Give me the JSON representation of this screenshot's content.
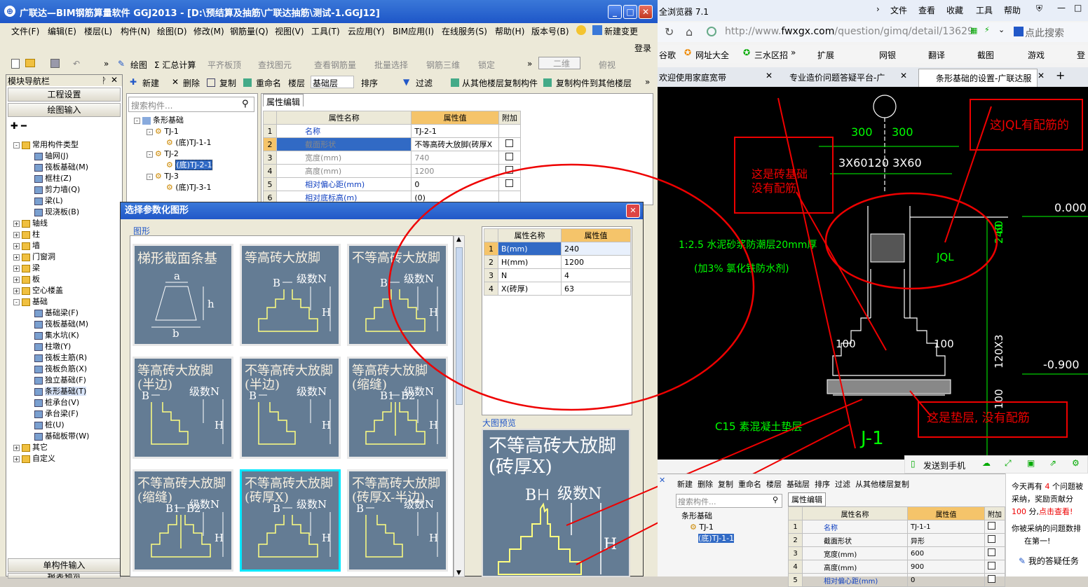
{
  "left_window": {
    "title": "广联达—BIM钢筋算量软件 GGJ2013 - [D:\\预结算及抽筋\\广联达抽筋\\测试-1.GGJ12]",
    "menu": [
      "文件(F)",
      "编辑(E)",
      "楼层(L)",
      "构件(N)",
      "绘图(D)",
      "修改(M)",
      "钢筋量(Q)",
      "视图(V)",
      "工具(T)",
      "云应用(Y)",
      "BIM应用(I)",
      "在线服务(S)",
      "帮助(H)",
      "版本号(B)",
      "新建变更"
    ],
    "login": "登录",
    "toolbar": [
      "绘图",
      "Σ 汇总计算",
      "平齐板顶",
      "查找图元",
      "查看钢筋量",
      "批量选择",
      "钢筋三维",
      "锁定",
      "二维",
      "俯视"
    ],
    "toolbar2": [
      "新建",
      "删除",
      "复制",
      "重命名",
      "楼层",
      "基础层",
      "排序",
      "过滤",
      "从其他楼层复制构件",
      "复制构件到其他楼层"
    ],
    "nav": {
      "title": "模块导航栏",
      "btn_setup": "工程设置",
      "btn_draw": "绘图输入",
      "btn_single": "单构件输入",
      "btn_report": "报表预览",
      "tree": [
        {
          "label": "常用构件类型",
          "level": 0,
          "folder": true,
          "exp": "-"
        },
        {
          "label": "轴网(J)",
          "level": 1
        },
        {
          "label": "筏板基础(M)",
          "level": 1
        },
        {
          "label": "框柱(Z)",
          "level": 1
        },
        {
          "label": "剪力墙(Q)",
          "level": 1
        },
        {
          "label": "梁(L)",
          "level": 1
        },
        {
          "label": "现浇板(B)",
          "level": 1
        },
        {
          "label": "轴线",
          "level": 0,
          "folder": true,
          "exp": "+"
        },
        {
          "label": "柱",
          "level": 0,
          "folder": true,
          "exp": "+"
        },
        {
          "label": "墙",
          "level": 0,
          "folder": true,
          "exp": "+"
        },
        {
          "label": "门窗洞",
          "level": 0,
          "folder": true,
          "exp": "+"
        },
        {
          "label": "梁",
          "level": 0,
          "folder": true,
          "exp": "+"
        },
        {
          "label": "板",
          "level": 0,
          "folder": true,
          "exp": "+"
        },
        {
          "label": "空心楼盖",
          "level": 0,
          "folder": true,
          "exp": "+"
        },
        {
          "label": "基础",
          "level": 0,
          "folder": true,
          "exp": "-"
        },
        {
          "label": "基础梁(F)",
          "level": 1
        },
        {
          "label": "筏板基础(M)",
          "level": 1
        },
        {
          "label": "集水坑(K)",
          "level": 1
        },
        {
          "label": "柱墩(Y)",
          "level": 1
        },
        {
          "label": "筏板主筋(R)",
          "level": 1
        },
        {
          "label": "筏板负筋(X)",
          "level": 1
        },
        {
          "label": "独立基础(F)",
          "level": 1
        },
        {
          "label": "条形基础(T)",
          "level": 1
        },
        {
          "label": "桩承台(V)",
          "level": 1
        },
        {
          "label": "承台梁(F)",
          "level": 1
        },
        {
          "label": "桩(U)",
          "level": 1
        },
        {
          "label": "基础板带(W)",
          "level": 1
        },
        {
          "label": "其它",
          "level": 0,
          "folder": true,
          "exp": "+"
        },
        {
          "label": "自定义",
          "level": 0,
          "folder": true,
          "exp": "+"
        }
      ]
    },
    "search_placeholder": "搜索构件...",
    "comp_tree": [
      "条形基础",
      "TJ-1",
      "(底)TJ-1-1",
      "TJ-2",
      "(底)TJ-2-1",
      "TJ-3",
      "(底)TJ-3-1"
    ],
    "prop_tab": "属性编辑",
    "prop_headers": [
      "属性名称",
      "属性值",
      "附加"
    ],
    "props": [
      {
        "n": "1",
        "name": "名称",
        "val": "TJ-2-1"
      },
      {
        "n": "2",
        "name": "截面形状",
        "val": "不等高砖大放脚(砖厚X"
      },
      {
        "n": "3",
        "name": "宽度(mm)",
        "val": "740"
      },
      {
        "n": "4",
        "name": "高度(mm)",
        "val": "1200"
      },
      {
        "n": "5",
        "name": "相对偏心距(mm)",
        "val": "0"
      },
      {
        "n": "6",
        "name": "相对底标高(m)",
        "val": "(0)"
      }
    ]
  },
  "dialog": {
    "title": "选择参数化图形",
    "group_shapes": "图形",
    "shapes": [
      {
        "cap": "梯形截面条基"
      },
      {
        "cap": "等高砖大放脚"
      },
      {
        "cap": "不等高砖大放脚"
      },
      {
        "cap": "等高砖大放脚(半边)"
      },
      {
        "cap": "不等高砖大放脚(半边)"
      },
      {
        "cap": "等高砖大放脚(缩缝)"
      },
      {
        "cap": "不等高砖大放脚(缩缝)"
      },
      {
        "cap": "不等高砖大放脚(砖厚X)"
      },
      {
        "cap": "不等高砖大放脚(砖厚X-半边)"
      }
    ],
    "lbl_a": "a",
    "lbl_b": "b",
    "lbl_h": "h",
    "lbl_B": "B",
    "lbl_N": "级数N",
    "lbl_H": "H",
    "lbl_B1": "B1",
    "lbl_B2": "B2",
    "param_headers": [
      "属性名称",
      "属性值"
    ],
    "params": [
      {
        "n": "1",
        "name": "B(mm)",
        "val": "240"
      },
      {
        "n": "2",
        "name": "H(mm)",
        "val": "1200"
      },
      {
        "n": "3",
        "name": "N",
        "val": "4"
      },
      {
        "n": "4",
        "name": "X(砖厚)",
        "val": "63"
      }
    ],
    "preview_label": "大图预览",
    "preview_caption": "不等高砖大放脚(砖厚X)"
  },
  "browser": {
    "title": "全浏览器 7.1",
    "menu": [
      "文件",
      "查看",
      "收藏",
      "工具",
      "帮助"
    ],
    "url_prefix": "http://www.",
    "url_host": "fwxgx.com",
    "url_path": "/question/gimq/detail/13629",
    "search_placeholder": "点此搜索",
    "favs": [
      "谷歌",
      "网址大全",
      "三水区招",
      "扩展",
      "网银",
      "翻译",
      "截图",
      "游戏",
      "登"
    ],
    "tabs": [
      "欢迎使用家庭宽带",
      "专业造价问题答疑平台-广",
      "条形基础的设置-广联达服"
    ],
    "send_mobile": "发送到手机"
  },
  "cad": {
    "dim_300a": "300",
    "dim_300b": "300",
    "dim_3x60": "3X60120 3X60",
    "note1": "1:2.5 水泥砂浆防潮层20mm厚",
    "note2": "(加3% 氯化铁防水剂)",
    "jql": "JQL",
    "dim_240": "240",
    "dim_60": "60",
    "elev_0": "0.000",
    "elev_m": "-0.900",
    "dim_100l": "100",
    "dim_100r": "100",
    "dim_120x3": "120X3",
    "dim_100b": "100",
    "pad": "C15 素混凝土垫层",
    "j1": "J-1",
    "ann_brick": "这是砖基础\n没有配筋",
    "ann_jql": "这JQL有配筋的",
    "ann_pad": "这是垫层, 没有配筋"
  },
  "sub": {
    "toolbar": [
      "新建",
      "删除",
      "复制",
      "重命名",
      "楼层",
      "基础层",
      "排序",
      "过滤",
      "从其他楼层复制"
    ],
    "search_placeholder": "搜索构件...",
    "tree": [
      "条形基础",
      "TJ-1",
      "(底)TJ-1-1"
    ],
    "tab": "属性编辑",
    "headers": [
      "属性名称",
      "属性值",
      "附加"
    ],
    "rows": [
      {
        "n": "1",
        "name": "名称",
        "val": "TJ-1-1"
      },
      {
        "n": "2",
        "name": "截面形状",
        "val": "异形"
      },
      {
        "n": "3",
        "name": "宽度(mm)",
        "val": "600"
      },
      {
        "n": "4",
        "name": "高度(mm)",
        "val": "900"
      },
      {
        "n": "5",
        "name": "相对偏心距(mm)",
        "val": "0"
      }
    ]
  },
  "notice": {
    "line1a": "今天再有 ",
    "line1b": "4",
    "line1c": " 个问题被",
    "line2": "采纳，奖励贡献分",
    "line3a": "100",
    "line3b": " 分,",
    "line3c": "点击查看!",
    "line4": "你被采纳的问题数排",
    "line5": "在第一!",
    "task": "我的答疑任务"
  }
}
